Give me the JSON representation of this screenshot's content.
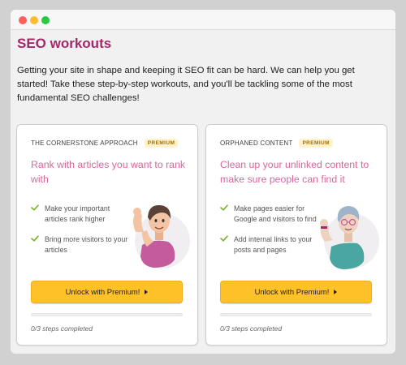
{
  "page": {
    "title": "SEO workouts",
    "intro": "Getting your site in shape and keeping it SEO fit can be hard. We can help you get started! Take these step-by-step workouts, and you'll be tackling some of the most fundamental SEO challenges!"
  },
  "colors": {
    "title": "#a4286a",
    "card_title": "#d7679b",
    "button": "#fec228",
    "check": "#77b227",
    "badge_bg": "#fff3cd"
  },
  "cards": [
    {
      "label": "THE CORNERSTONE APPROACH",
      "badge": "PREMIUM",
      "title": "Rank with articles you want to rank with",
      "features": [
        "Make your important articles rank higher",
        "Bring more visitors to your articles"
      ],
      "button": "Unlock with Premium!",
      "steps": "0/3 steps completed",
      "progress": 0,
      "illustration": "flexing-man-illustration"
    },
    {
      "label": "ORPHANED CONTENT",
      "badge": "PREMIUM",
      "title": "Clean up your unlinked content to make sure people can find it",
      "features": [
        "Make pages easier for Google and visitors to find",
        "Add internal links to your posts and pages"
      ],
      "button": "Unlock with Premium!",
      "steps": "0/3 steps completed",
      "progress": 0,
      "illustration": "flexing-woman-illustration"
    }
  ]
}
